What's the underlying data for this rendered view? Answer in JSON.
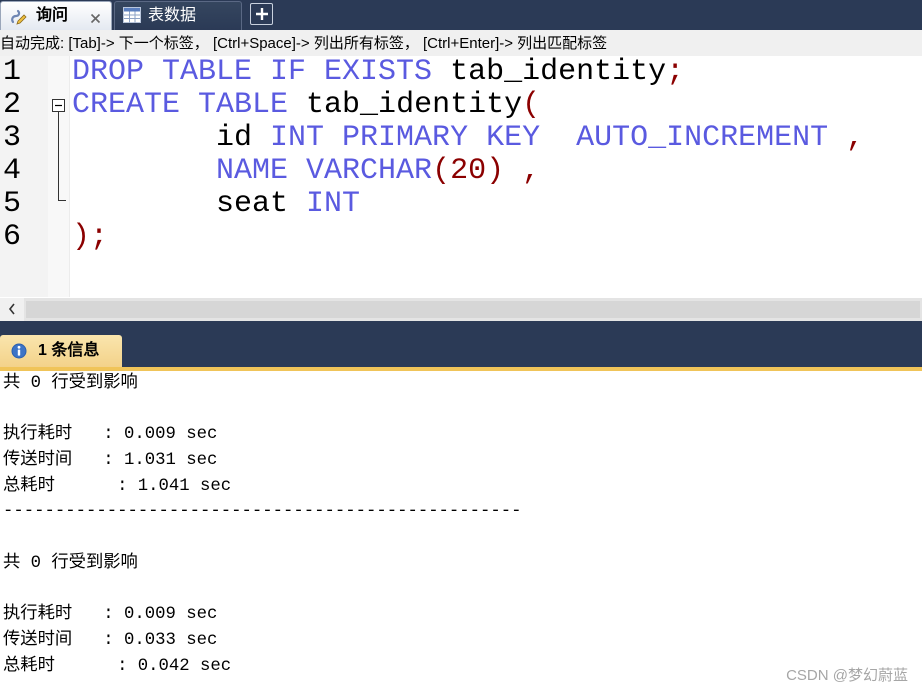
{
  "query_tabs": {
    "items": [
      {
        "label": "询问",
        "icon": "query-icon",
        "close_icon": "close-icon",
        "active": true
      },
      {
        "label": "表数据",
        "icon": "table-grid-icon",
        "active": false
      }
    ],
    "new_tab_button_icon": "plus-icon"
  },
  "autocomplete_hint": "自动完成: [Tab]-> 下一个标签， [Ctrl+Space]-> 列出所有标签， [Ctrl+Enter]-> 列出匹配标签",
  "editor": {
    "line_numbers": [
      "1",
      "2",
      "3",
      "4",
      "5",
      "6"
    ],
    "lines": [
      {
        "tokens": [
          {
            "text": "DROP TABLE IF EXISTS",
            "type": "keyword"
          },
          {
            "text": " tab_identity",
            "type": "identifier"
          },
          {
            "text": ";",
            "type": "punctuation"
          }
        ]
      },
      {
        "tokens": [
          {
            "text": "CREATE TABLE",
            "type": "keyword"
          },
          {
            "text": " tab_identity",
            "type": "identifier"
          },
          {
            "text": "(",
            "type": "punctuation"
          }
        ]
      },
      {
        "tokens": [
          {
            "text": "        id",
            "type": "identifier"
          },
          {
            "text": " INT PRIMARY KEY  AUTO_INCREMENT",
            "type": "keyword"
          },
          {
            "text": " ,",
            "type": "punctuation"
          }
        ]
      },
      {
        "tokens": [
          {
            "text": "        NAME VARCHAR",
            "type": "keyword"
          },
          {
            "text": "(",
            "type": "punctuation"
          },
          {
            "text": "20",
            "type": "number"
          },
          {
            "text": ")",
            "type": "punctuation"
          },
          {
            "text": " ,",
            "type": "punctuation"
          }
        ]
      },
      {
        "tokens": [
          {
            "text": "        seat",
            "type": "identifier"
          },
          {
            "text": " INT",
            "type": "keyword"
          }
        ]
      },
      {
        "tokens": [
          {
            "text": ");",
            "type": "punctuation"
          }
        ]
      }
    ],
    "fold_marker_icon": "fold-collapse-icon"
  },
  "h_scrollbar": {
    "left_arrow_icon": "chevron-left-icon"
  },
  "results": {
    "tab": {
      "label": "1 条信息",
      "icon": "info-icon",
      "active": true
    },
    "message_blocks": [
      {
        "affected_rows": "共 0 行受到影响",
        "execution_time": "执行耗时   : 0.009 sec",
        "transfer_time": "传送时间   : 1.031 sec",
        "total_time": "总耗时      : 1.041 sec",
        "separator": "--------------------------------------------------"
      },
      {
        "affected_rows": "共 0 行受到影响",
        "execution_time": "执行耗时   : 0.009 sec",
        "transfer_time": "传送时间   : 0.033 sec",
        "total_time": "总耗时      : 0.042 sec"
      }
    ]
  },
  "watermark": "CSDN @梦幻蔚蓝",
  "colors": {
    "keyword": "#5a5ae0",
    "identifier": "#000000",
    "punctuation": "#8b0000",
    "number": "#8b0000",
    "tab_bar": "#2b3a56",
    "results_tab": "#f3d28a",
    "results_accent": "#f0c459",
    "watermark": "#a6a6a6"
  }
}
